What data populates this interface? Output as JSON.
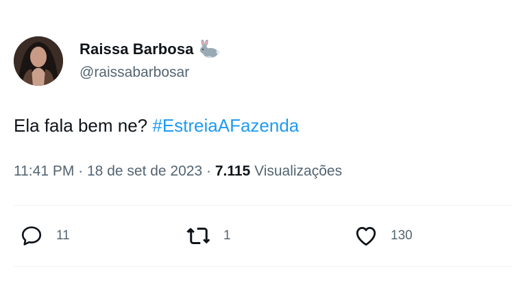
{
  "user": {
    "display_name": "Raissa Barbosa",
    "handle": "@raissabarbosar",
    "emoji": "rabbit-emoji"
  },
  "tweet": {
    "text": "Ela fala bem ne? ",
    "hashtag": "#EstreiaAFazenda",
    "time": "11:41 PM",
    "date": "18 de set de 2023",
    "views_count": "7.115",
    "views_label": "Visualizações"
  },
  "actions": {
    "replies": "11",
    "retweets": "1",
    "likes": "130"
  },
  "icons": {
    "reply": "comment-bubble-icon",
    "retweet": "retweet-arrows-icon",
    "like": "heart-icon"
  },
  "colors": {
    "text": "#0f1419",
    "secondary": "#536471",
    "link": "#1d9bf0",
    "divider": "#eff3f4"
  }
}
